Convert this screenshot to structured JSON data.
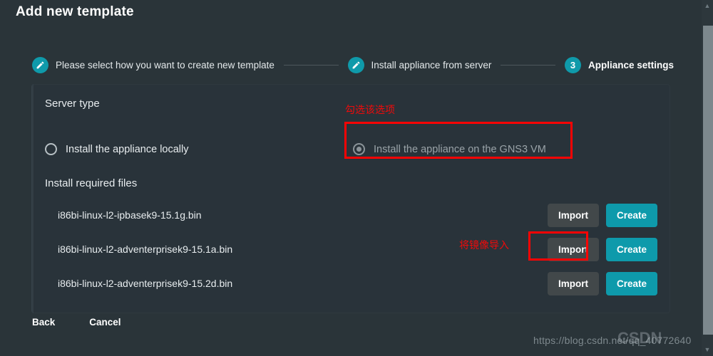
{
  "dialog": {
    "title": "Add new template"
  },
  "stepper": {
    "steps": [
      {
        "label": "Please select how you want to create new template",
        "marker": "pencil-icon",
        "state": "done"
      },
      {
        "label": "Install appliance from server",
        "marker": "pencil-icon",
        "state": "done"
      },
      {
        "label": "Appliance settings",
        "marker": "3",
        "state": "current"
      }
    ]
  },
  "server_type": {
    "heading": "Server type",
    "options": [
      {
        "label": "Install the appliance locally",
        "selected": false,
        "disabled": false
      },
      {
        "label": "Install the appliance on the GNS3 VM",
        "selected": true,
        "disabled": true
      }
    ]
  },
  "required_files": {
    "heading": "Install required files",
    "import_label": "Import",
    "create_label": "Create",
    "rows": [
      {
        "filename": "i86bi-linux-l2-ipbasek9-15.1g.bin"
      },
      {
        "filename": "i86bi-linux-l2-adventerprisek9-15.1a.bin"
      },
      {
        "filename": "i86bi-linux-l2-adventerprisek9-15.2d.bin"
      }
    ]
  },
  "footer": {
    "back_label": "Back",
    "cancel_label": "Cancel"
  },
  "annotations": [
    {
      "text": "勾选该选项",
      "target": "gns3-vm-radio"
    },
    {
      "text": "将镜像导入",
      "target": "import-button-row-2"
    }
  ],
  "watermark": {
    "url": "https://blog.csdn.net/qq_40772640",
    "logo": "CSDN"
  },
  "scrollbar": {
    "up_arrow": "▲",
    "down_arrow": "▼"
  },
  "colors": {
    "accent": "#0e9aab",
    "background": "#2a3439",
    "panel": "#29333a",
    "import_button": "#42484a",
    "annotation_red": "#fb0505",
    "disabled_text": "#9aa3a8"
  }
}
